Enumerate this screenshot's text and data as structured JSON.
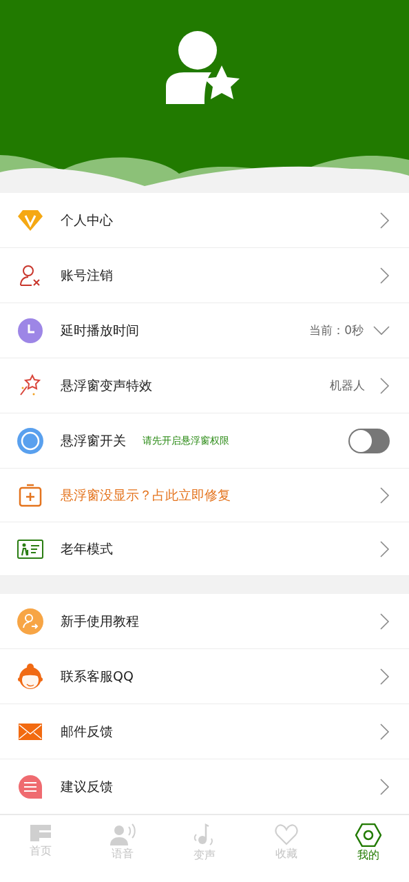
{
  "groups": [
    {
      "items": [
        {
          "kind": "link",
          "label": "个人中心"
        },
        {
          "kind": "link",
          "label": "账号注销"
        },
        {
          "kind": "dropdown",
          "label": "延时播放时间",
          "value": "当前：0秒"
        },
        {
          "kind": "link",
          "label": "悬浮窗变声特效",
          "value": "机器人"
        },
        {
          "kind": "toggle",
          "label": "悬浮窗开关",
          "note": "请先开启悬浮窗权限",
          "on": false
        },
        {
          "kind": "warning",
          "label": "悬浮窗没显示？占此立即修复"
        },
        {
          "kind": "link",
          "label": "老年模式"
        }
      ]
    },
    {
      "items": [
        {
          "kind": "link",
          "label": "新手使用教程"
        },
        {
          "kind": "link",
          "label": "联系客服QQ"
        },
        {
          "kind": "link",
          "label": "邮件反馈"
        },
        {
          "kind": "link",
          "label": "建议反馈"
        }
      ]
    }
  ],
  "tabs": [
    {
      "label": "首页",
      "selected": false
    },
    {
      "label": "语音",
      "selected": false
    },
    {
      "label": "变声",
      "selected": false
    },
    {
      "label": "收藏",
      "selected": false
    },
    {
      "label": "我的",
      "selected": true
    }
  ]
}
